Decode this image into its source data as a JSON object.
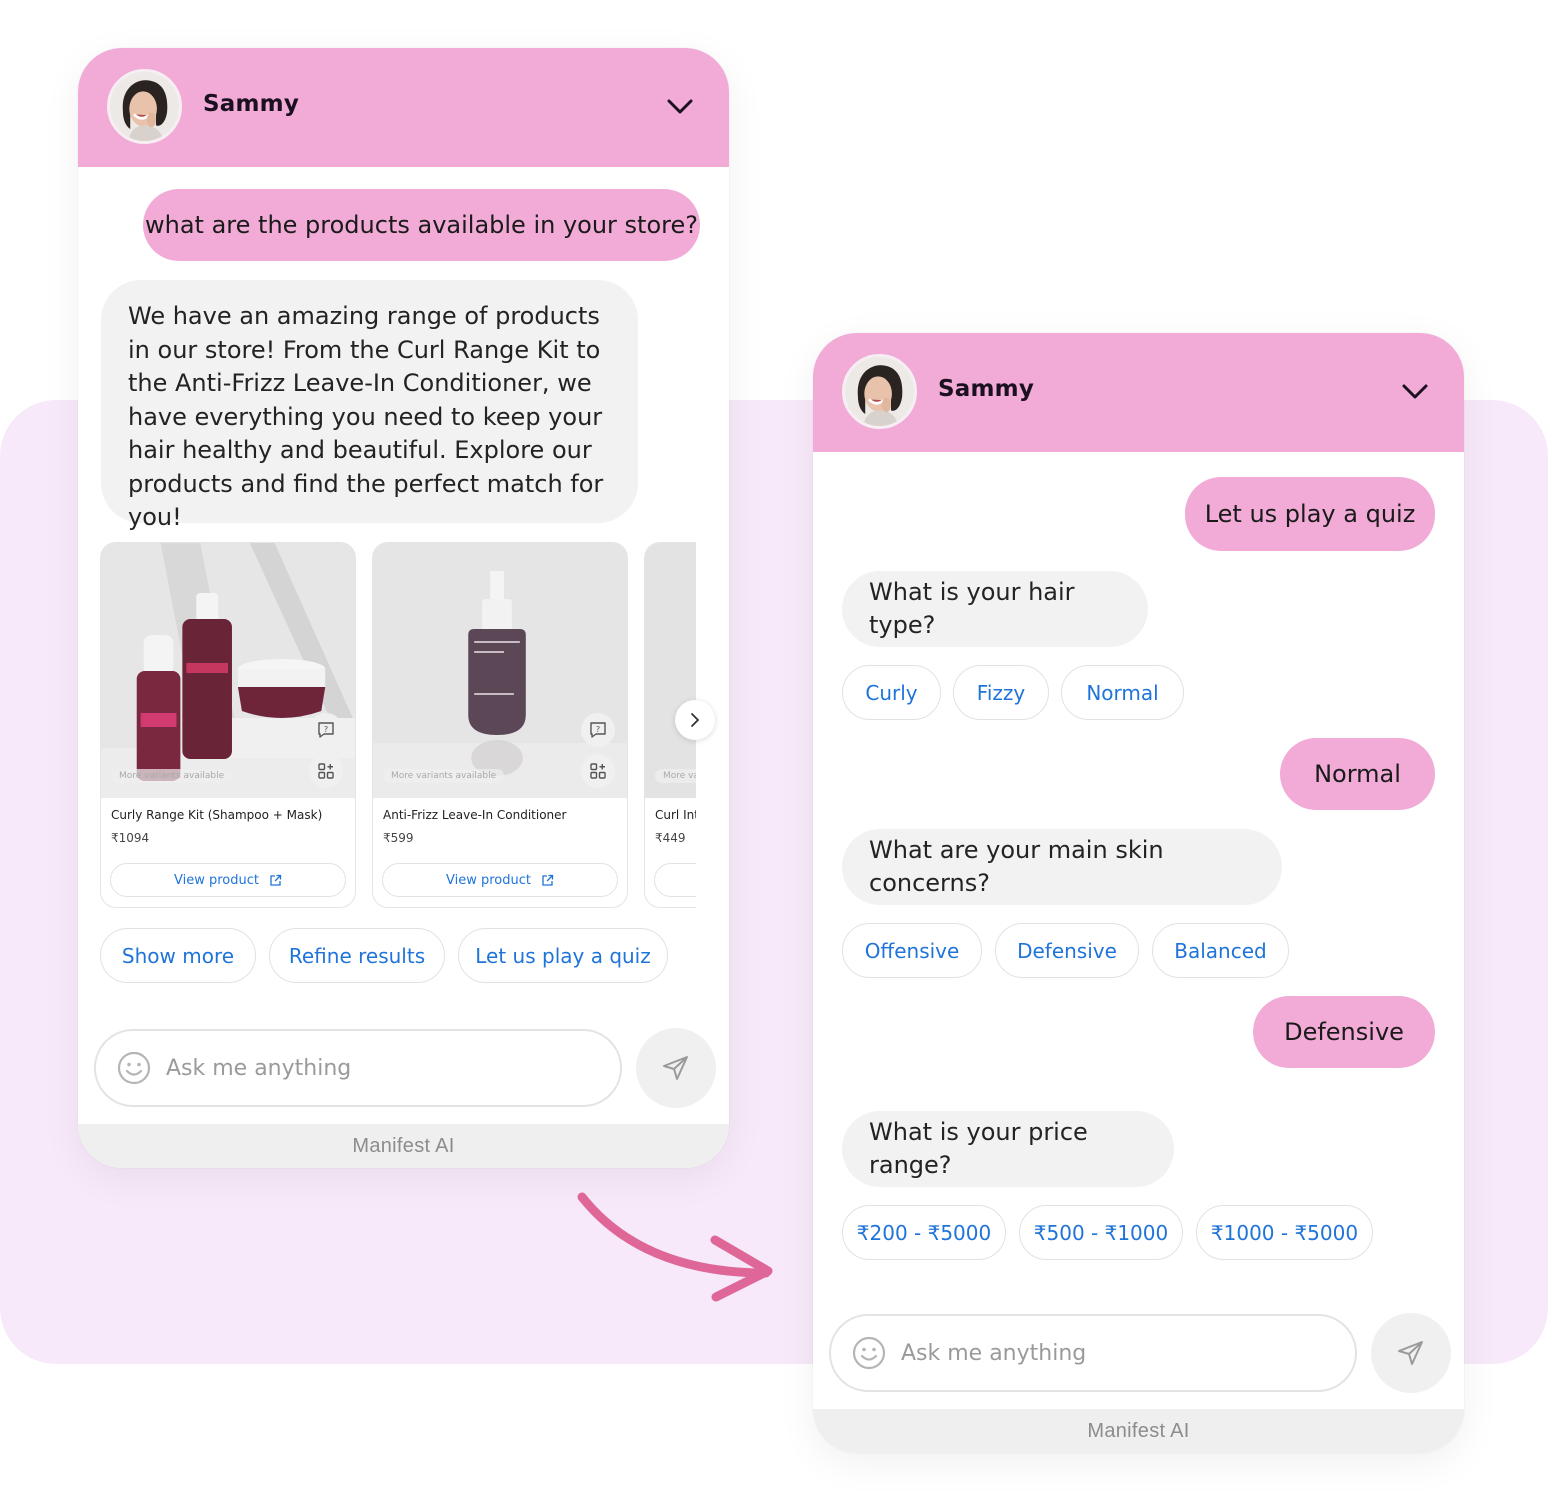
{
  "colors": {
    "header_pink": "#f1abd6",
    "user_bubble": "#f1abd6",
    "bot_bubble": "#f2f2f2",
    "chip_text": "#1f74d9",
    "backdrop": "#f7e9f9",
    "arrow": "#df6797"
  },
  "left_widget": {
    "header": {
      "agent_name": "Sammy",
      "collapse_icon": "chevron-down-icon"
    },
    "messages": [
      {
        "role": "user",
        "text": "what are the products available in your store?"
      },
      {
        "role": "bot",
        "text": "We have an amazing range of products in our store! From the Curl Range Kit to the Anti-Frizz Leave-In Conditioner, we have everything you need to keep your hair healthy and beautiful. Explore our products and find the perfect match for you!"
      }
    ],
    "products": [
      {
        "title": "Curly Range Kit (Shampoo + Mask)",
        "price": "₹1094",
        "variants_label": "More variants available",
        "cta": "View product"
      },
      {
        "title": "Anti-Frizz Leave-In Conditioner",
        "price": "₹599",
        "variants_label": "More variants available",
        "cta": "View product"
      },
      {
        "title": "Curl Int",
        "price": "₹449",
        "variants_label": "More var",
        "cta": ""
      }
    ],
    "quick_replies": [
      "Show more",
      "Refine results",
      "Let us play a quiz"
    ],
    "composer": {
      "placeholder": "Ask me anything"
    },
    "footer": "Manifest AI"
  },
  "right_widget": {
    "header": {
      "agent_name": "Sammy",
      "collapse_icon": "chevron-down-icon"
    },
    "messages": [
      {
        "role": "user",
        "text": "Let us play a quiz"
      },
      {
        "role": "bot",
        "text": "What is your hair type?",
        "options": [
          "Curly",
          "Fizzy",
          "Normal"
        ]
      },
      {
        "role": "user",
        "text": "Normal"
      },
      {
        "role": "bot",
        "text": "What are your main skin concerns?",
        "options": [
          "Offensive",
          "Defensive",
          "Balanced"
        ]
      },
      {
        "role": "user",
        "text": "Defensive"
      },
      {
        "role": "bot",
        "text": "What is your price range?",
        "options": [
          "₹200 - ₹5000",
          "₹500 - ₹1000",
          "₹1000 - ₹5000"
        ]
      }
    ],
    "composer": {
      "placeholder": "Ask me anything"
    },
    "footer": "Manifest AI"
  }
}
